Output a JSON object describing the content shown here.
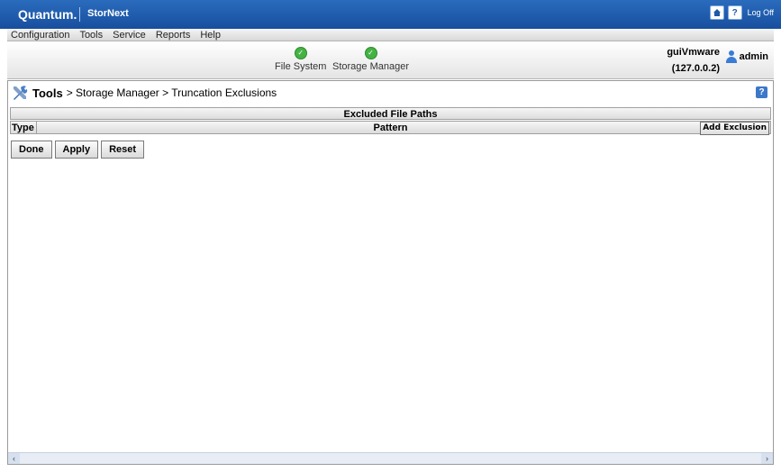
{
  "header": {
    "brand": "Quantum.",
    "product": "StorNext",
    "logoff_label": "Log Off",
    "icons": [
      "home-icon",
      "help-icon"
    ]
  },
  "menu": [
    "Configuration",
    "Tools",
    "Service",
    "Reports",
    "Help"
  ],
  "status": {
    "items": [
      {
        "label": "File System",
        "state": "ok"
      },
      {
        "label": "Storage Manager",
        "state": "ok"
      }
    ],
    "host": "guiVmware",
    "ip": "(127.0.0.2)",
    "user": "admin"
  },
  "page": {
    "section": "Tools",
    "breadcrumb_rest": " > Storage Manager > Truncation Exclusions"
  },
  "table": {
    "title": "Excluded File Paths",
    "columns": [
      "Type",
      "Pattern"
    ],
    "add_button": "Add Exclusion",
    "rows": []
  },
  "buttons": {
    "done": "Done",
    "apply": "Apply",
    "reset": "Reset"
  },
  "colors": {
    "header_blue": "#2a6bbd",
    "ok_green": "#44b344"
  }
}
